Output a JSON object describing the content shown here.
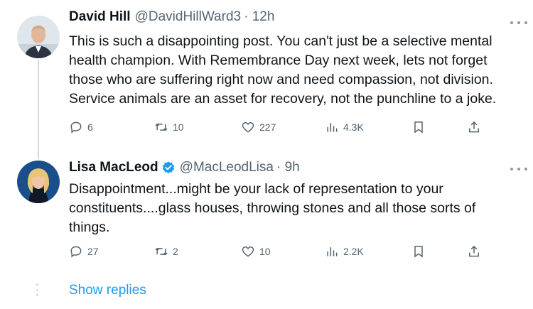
{
  "tweets": [
    {
      "author_name": "David Hill",
      "handle": "@DavidHillWard3",
      "time": "· 12h",
      "verified": false,
      "text_lines": [
        "This is such a disappointing post.  You can't just be a selective mental",
        "health champion.  With Remembrance Day next week, lets not forget",
        "those who are suffering right now and need compassion, not division.",
        "Service animals are an asset for recovery, not the punchline to a joke."
      ],
      "replies": "6",
      "retweets": "10",
      "likes": "227",
      "views": "4.3K"
    },
    {
      "author_name": "Lisa MacLeod",
      "handle": "@MacLeodLisa",
      "time": "· 9h",
      "verified": true,
      "text_lines": [
        "Disappointment...might be your lack of representation to your",
        "constituents....glass houses, throwing stones and all those sorts of",
        "things."
      ],
      "replies": "27",
      "retweets": "2",
      "likes": "10",
      "views": "2.2K"
    }
  ],
  "show_replies_label": "Show replies",
  "icons": {
    "reply": "reply-icon",
    "retweet": "retweet-icon",
    "like": "like-icon",
    "views": "views-icon",
    "bookmark": "bookmark-icon",
    "share": "share-icon",
    "more": "more-icon",
    "verified": "verified-badge-icon"
  },
  "colors": {
    "text": "#0f1419",
    "secondary": "#536471",
    "link": "#1d9bf0",
    "verified": "#1d9bf0",
    "thread_line": "#cfd9de"
  }
}
